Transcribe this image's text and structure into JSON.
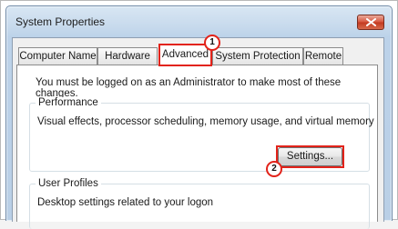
{
  "window": {
    "title": "System Properties",
    "close_icon": "close-icon"
  },
  "tabs": [
    {
      "label": "Computer Name",
      "active": false
    },
    {
      "label": "Hardware",
      "active": false
    },
    {
      "label": "Advanced",
      "active": true
    },
    {
      "label": "System Protection",
      "active": false
    },
    {
      "label": "Remote",
      "active": false
    }
  ],
  "advanced": {
    "admin_message": "You must be logged on as an Administrator to make most of these changes.",
    "performance": {
      "label": "Performance",
      "description": "Visual effects, processor scheduling, memory usage, and virtual memory",
      "settings_label": "Settings..."
    },
    "user_profiles": {
      "label": "User Profiles",
      "description": "Desktop settings related to your logon"
    }
  },
  "annotations": {
    "step1": "1",
    "step2": "2",
    "highlight_color": "#e2231a"
  }
}
